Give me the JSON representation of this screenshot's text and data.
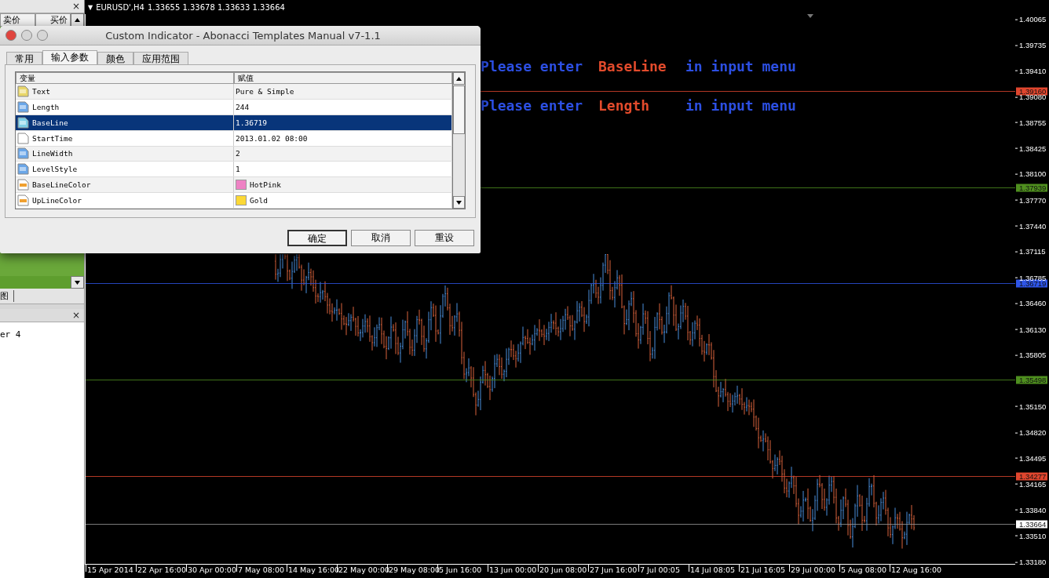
{
  "left_panel": {
    "close_top": "×",
    "columns": [
      "卖价",
      "买价"
    ],
    "tab_fragment": "图",
    "close_bottom": "×",
    "list_item": "er 4"
  },
  "chart": {
    "menu_mark": "▼",
    "symbol": "EURUSD',H4",
    "ohlc": "1.33655 1.33678 1.33633 1.33664",
    "messages": [
      [
        {
          "text": "Please enter",
          "kind": "plain"
        },
        {
          "text": "BaseLine",
          "kind": "name"
        },
        {
          "text": "in input menu",
          "kind": "plain"
        }
      ],
      [
        {
          "text": "Please enter",
          "kind": "plain"
        },
        {
          "text": "Length",
          "kind": "name"
        },
        {
          "text": "in input menu",
          "kind": "plain"
        }
      ]
    ],
    "price_ticks": [
      "1.40065",
      "1.39735",
      "1.39410",
      "1.39080",
      "1.38755",
      "1.38425",
      "1.38100",
      "1.37770",
      "1.37440",
      "1.37115",
      "1.36785",
      "1.36460",
      "1.36130",
      "1.35805",
      "1.35150",
      "1.34820",
      "1.34495",
      "1.34165",
      "1.33840",
      "1.33510",
      "1.33180"
    ],
    "levels": [
      {
        "price": "1.39160",
        "color": "#e0462e"
      },
      {
        "price": "1.37939",
        "color": "#4f8f1f"
      },
      {
        "price": "1.36719",
        "color": "#2e55e8"
      },
      {
        "price": "1.35498",
        "color": "#4f8f1f"
      },
      {
        "price": "1.34277",
        "color": "#e0462e"
      },
      {
        "price": "1.33664",
        "color": "#ffffff"
      }
    ],
    "time_labels": [
      "15 Apr 2014",
      "22 Apr 16:00",
      "30 Apr 00:00",
      "7 May 08:00",
      "14 May 16:00",
      "22 May 00:00",
      "29 May 08:00",
      "5 Jun 16:00",
      "13 Jun 00:00",
      "20 Jun 08:00",
      "27 Jun 16:00",
      "7 Jul 00:05",
      "14 Jul 08:05",
      "21 Jul 16:05",
      "29 Jul 00:00",
      "5 Aug 08:00",
      "12 Aug 16:00"
    ]
  },
  "dialog": {
    "title": "Custom Indicator - Abonacci Templates Manual v7-1.1",
    "tabs": [
      {
        "label": "常用",
        "selected": false
      },
      {
        "label": "输入参数",
        "selected": true
      },
      {
        "label": "颜色",
        "selected": false
      },
      {
        "label": "应用范围",
        "selected": false
      }
    ],
    "columns": [
      "变量",
      "赋值"
    ],
    "rows": [
      {
        "kind": "text",
        "name": "Text",
        "value": "Pure & Simple",
        "selected": false
      },
      {
        "kind": "integer",
        "name": "Length",
        "value": "244",
        "selected": false
      },
      {
        "kind": "double",
        "name": "BaseLine",
        "value": "1.36719",
        "selected": true
      },
      {
        "kind": "datetime",
        "name": "StartTime",
        "value": "2013.01.02 08:00",
        "selected": false
      },
      {
        "kind": "integer",
        "name": "LineWidth",
        "value": "2",
        "selected": false
      },
      {
        "kind": "integer",
        "name": "LevelStyle",
        "value": "1",
        "selected": false
      },
      {
        "kind": "color",
        "name": "BaseLineColor",
        "value": "HotPink",
        "color": "#ee82c4",
        "selected": false
      },
      {
        "kind": "color",
        "name": "UpLineColor",
        "value": "Gold",
        "color": "#fcd836",
        "selected": false
      }
    ],
    "buttons": [
      {
        "label": "确定",
        "default": true
      },
      {
        "label": "取消",
        "default": false
      },
      {
        "label": "重设",
        "default": false
      }
    ]
  }
}
